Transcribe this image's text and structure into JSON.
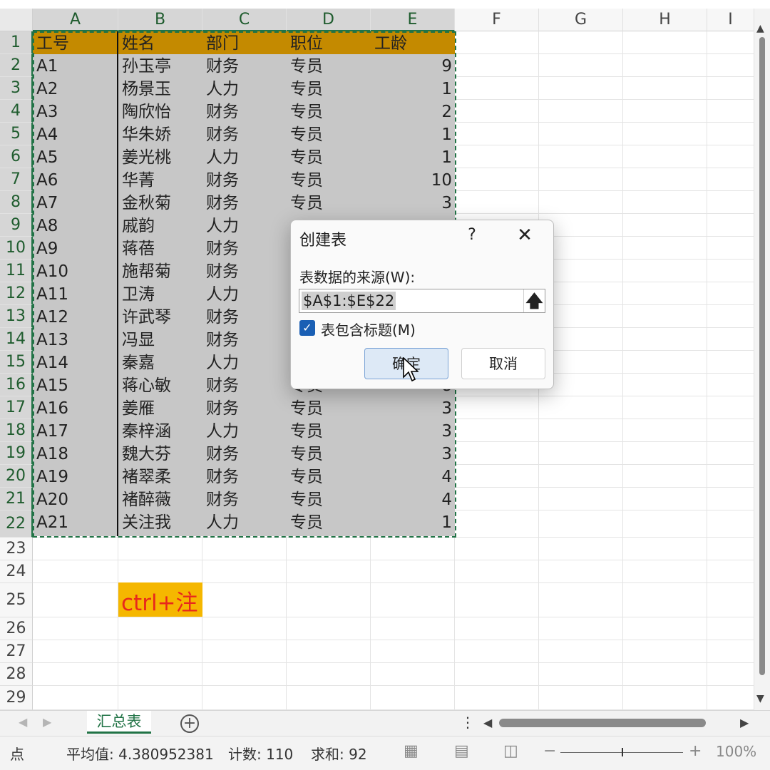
{
  "columns": [
    "A",
    "B",
    "C",
    "D",
    "E",
    "F",
    "G",
    "H",
    "I"
  ],
  "rows": [
    "1",
    "2",
    "3",
    "4",
    "5",
    "6",
    "7",
    "8",
    "9",
    "10",
    "11",
    "12",
    "13",
    "14",
    "15",
    "16",
    "17",
    "18",
    "19",
    "20",
    "21",
    "22",
    "23",
    "24",
    "25",
    "26",
    "27",
    "28",
    "29"
  ],
  "table": {
    "headers": [
      "工号",
      "姓名",
      "部门",
      "职位",
      "工龄"
    ],
    "records": [
      [
        "A1",
        "孙玉亭",
        "财务",
        "专员",
        "9"
      ],
      [
        "A2",
        "杨景玉",
        "人力",
        "专员",
        "1"
      ],
      [
        "A3",
        "陶欣怡",
        "财务",
        "专员",
        "2"
      ],
      [
        "A4",
        "华朱娇",
        "财务",
        "专员",
        "1"
      ],
      [
        "A5",
        "姜光桃",
        "人力",
        "专员",
        "1"
      ],
      [
        "A6",
        "华菁",
        "财务",
        "专员",
        "10"
      ],
      [
        "A7",
        "金秋菊",
        "财务",
        "专员",
        "3"
      ],
      [
        "A8",
        "戚韵",
        "人力",
        "",
        ""
      ],
      [
        "A9",
        "蒋蓓",
        "财务",
        "",
        ""
      ],
      [
        "A10",
        "施帮菊",
        "财务",
        "",
        ""
      ],
      [
        "A11",
        "卫涛",
        "人力",
        "",
        ""
      ],
      [
        "A12",
        "许武琴",
        "财务",
        "",
        ""
      ],
      [
        "A13",
        "冯显",
        "财务",
        "",
        ""
      ],
      [
        "A14",
        "秦嘉",
        "人力",
        "",
        ""
      ],
      [
        "A15",
        "蒋心敏",
        "财务",
        "专员",
        "8"
      ],
      [
        "A16",
        "姜雁",
        "财务",
        "专员",
        "3"
      ],
      [
        "A17",
        "秦梓涵",
        "人力",
        "专员",
        "3"
      ],
      [
        "A18",
        "魏大芬",
        "财务",
        "专员",
        "3"
      ],
      [
        "A19",
        "褚翠柔",
        "财务",
        "专员",
        "4"
      ],
      [
        "A20",
        "褚醉薇",
        "财务",
        "专员",
        "4"
      ],
      [
        "A21",
        "关注我",
        "人力",
        "专员",
        "1"
      ]
    ]
  },
  "dialog": {
    "title": "创建表",
    "help": "?",
    "close": "✕",
    "source_label": "表数据的来源(W):",
    "source_value": "$A$1:$E$22",
    "collapse_icon": "🡅",
    "has_headers_checked": true,
    "check_mark": "✓",
    "has_headers_label": "表包含标题(M)",
    "ok_label": "确定",
    "cancel_label": "取消"
  },
  "overlay_caption": "ctrl+注",
  "sheet_tab": "汇总表",
  "add_sheet": "+",
  "status": {
    "mode": "点",
    "average": "平均值: 4.380952381",
    "count": "计数: 110",
    "sum": "求和: 92",
    "zoom": "100%"
  },
  "colors": {
    "accent": "#217346",
    "header_fill": "#c48a00",
    "selection_fill": "#c7c7c7",
    "caption_bg": "#f5b700",
    "caption_text": "#e8281c"
  }
}
